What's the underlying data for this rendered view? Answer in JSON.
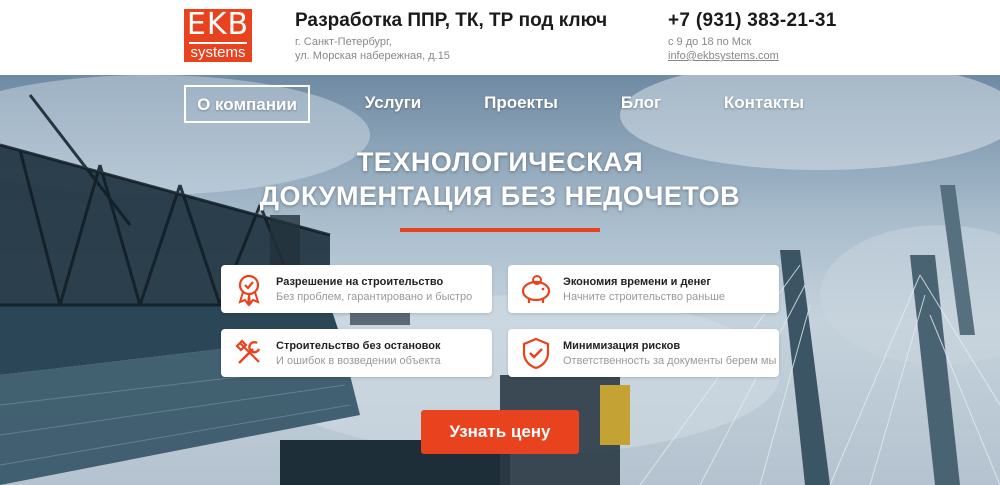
{
  "header": {
    "logo": {
      "top": "EKB",
      "bottom": "systems"
    },
    "tagline": "Разработка ППР, ТК, ТР под ключ",
    "address_line1": "г. Санкт-Петербург,",
    "address_line2": "ул. Морская набережная, д.15",
    "phone": "+7 (931) 383-21-31",
    "hours": "с 9 до 18 по Мск",
    "email": "info@ekbsystems.com"
  },
  "nav": {
    "items": [
      {
        "label": "О компании",
        "active": true
      },
      {
        "label": "Услуги",
        "active": false
      },
      {
        "label": "Проекты",
        "active": false
      },
      {
        "label": "Блог",
        "active": false
      },
      {
        "label": "Контакты",
        "active": false
      }
    ]
  },
  "hero": {
    "headline_line1": "ТЕХНОЛОГИЧЕСКАЯ",
    "headline_line2": "ДОКУМЕНТАЦИЯ БЕЗ НЕДОЧЕТОВ",
    "accent_color": "#e8421f",
    "cards": [
      {
        "icon": "award-icon",
        "title": "Разрешение на строительство",
        "subtitle": "Без проблем, гарантировано и быстро"
      },
      {
        "icon": "piggy-bank-icon",
        "title": "Экономия времени и денег",
        "subtitle": "Начните строительство раньше"
      },
      {
        "icon": "tools-icon",
        "title": "Строительство без остановок",
        "subtitle": "И ошибок в возведении объекта"
      },
      {
        "icon": "shield-check-icon",
        "title": "Минимизация рисков",
        "subtitle": "Ответственность за документы берем мы"
      }
    ],
    "cta_label": "Узнать цену"
  }
}
